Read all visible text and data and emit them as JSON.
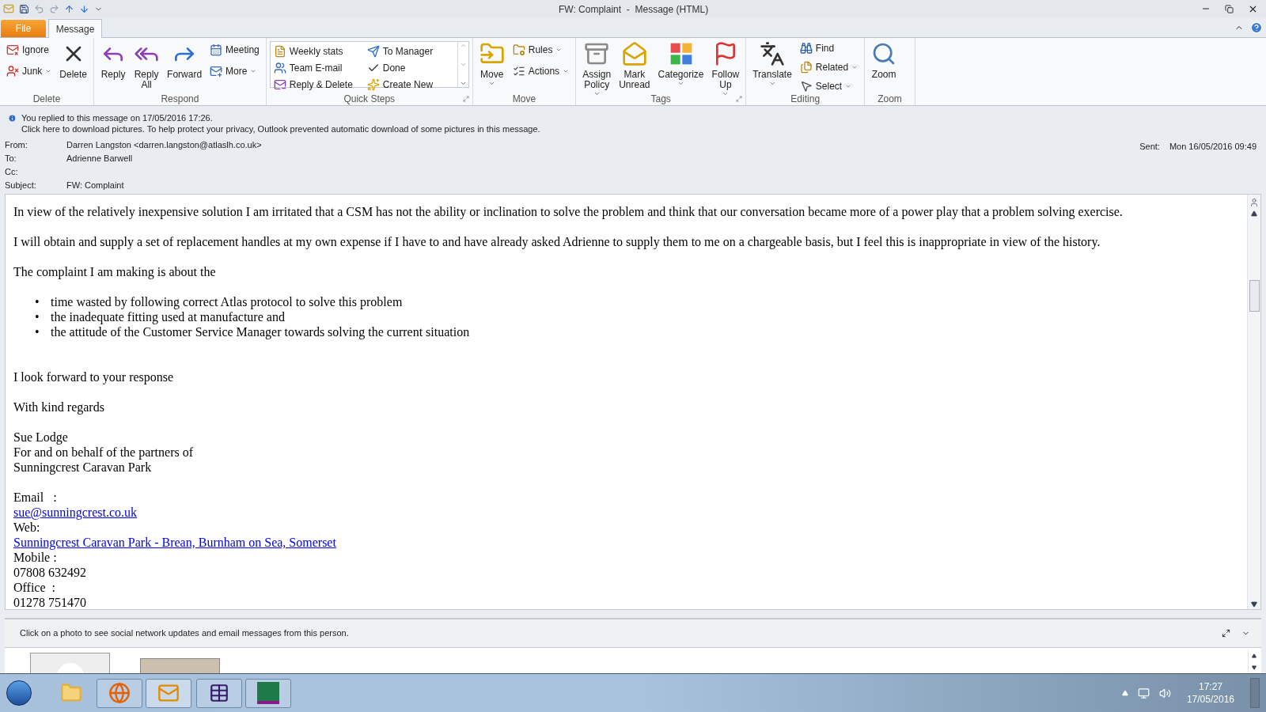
{
  "window": {
    "title": "FW: Complaint  -  Message (HTML)"
  },
  "tabs": [
    {
      "label": "File",
      "kind": "file",
      "selected": false
    },
    {
      "label": "Message",
      "kind": "tab",
      "selected": true
    }
  ],
  "ribbon": {
    "groups": [
      {
        "label": "Delete",
        "launcher": false,
        "items": [
          {
            "kind": "stack",
            "buttons": [
              {
                "label": "Ignore",
                "dropdown": false
              },
              {
                "label": "Junk",
                "dropdown": true
              }
            ]
          },
          {
            "kind": "large",
            "label": "Delete",
            "dropdown": false
          }
        ]
      },
      {
        "label": "Respond",
        "launcher": false,
        "items": [
          {
            "kind": "large",
            "label": "Reply",
            "dropdown": false
          },
          {
            "kind": "large",
            "label": "Reply\nAll",
            "dropdown": false
          },
          {
            "kind": "large",
            "label": "Forward",
            "dropdown": false
          },
          {
            "kind": "stack",
            "buttons": [
              {
                "label": "Meeting",
                "dropdown": false
              },
              {
                "label": "More",
                "dropdown": true
              }
            ]
          }
        ]
      },
      {
        "label": "Quick Steps",
        "launcher": true,
        "items": [
          {
            "kind": "gallery",
            "buttons": [
              {
                "label": "Weekly stats",
                "dropdown": false
              },
              {
                "label": "To Manager",
                "dropdown": false
              },
              {
                "label": "Team E-mail",
                "dropdown": false
              },
              {
                "label": "Done",
                "dropdown": false
              },
              {
                "label": "Reply & Delete",
                "dropdown": false
              },
              {
                "label": "Create New",
                "dropdown": false
              }
            ]
          }
        ]
      },
      {
        "label": "Move",
        "launcher": false,
        "items": [
          {
            "kind": "large",
            "label": "Move",
            "dropdown": true
          },
          {
            "kind": "stack",
            "buttons": [
              {
                "label": "Rules",
                "dropdown": true
              },
              {
                "label": "Actions",
                "dropdown": true
              }
            ]
          }
        ]
      },
      {
        "label": "Tags",
        "launcher": true,
        "items": [
          {
            "kind": "large",
            "label": "Assign\nPolicy",
            "dropdown": true
          },
          {
            "kind": "large",
            "label": "Mark\nUnread",
            "dropdown": false
          },
          {
            "kind": "large",
            "label": "Categorize",
            "dropdown": true
          },
          {
            "kind": "large",
            "label": "Follow\nUp",
            "dropdown": true
          }
        ]
      },
      {
        "label": "Editing",
        "launcher": false,
        "items": [
          {
            "kind": "large",
            "label": "Translate",
            "dropdown": true
          },
          {
            "kind": "stack",
            "buttons": [
              {
                "label": "Find",
                "dropdown": false
              },
              {
                "label": "Related",
                "dropdown": true
              },
              {
                "label": "Select",
                "dropdown": true
              }
            ]
          }
        ]
      },
      {
        "label": "Zoom",
        "launcher": false,
        "items": [
          {
            "kind": "large",
            "label": "Zoom",
            "dropdown": false
          }
        ]
      }
    ]
  },
  "info_bar": [
    "You replied to this message on 17/05/2016 17:26.",
    "Click here to download pictures. To help protect your privacy, Outlook prevented automatic download of some pictures in this message."
  ],
  "headers": [
    {
      "label": "From:",
      "value": "Darren Langston <darren.langston@atlaslh.co.uk>"
    },
    {
      "label": "To:",
      "value": "Adrienne Barwell"
    },
    {
      "label": "Cc:"
    },
    {
      "label": "Subject:",
      "value": "FW: Complaint"
    }
  ],
  "sent": {
    "label": "Sent:",
    "value": "Mon 16/05/2016 09:49"
  },
  "body": [
    {
      "kind": "paragraph",
      "text": "In view of the relatively inexpensive solution I am irritated that a CSM has not the ability or inclination to solve the problem and think that our conversation became more of a power play that a problem solving exercise."
    },
    {
      "kind": "paragraph",
      "text": "I will obtain and supply a set of replacement handles at my own expense if I have to and have already asked Adrienne to supply them to me on a chargeable basis, but I feel this is inappropriate in view of the history."
    },
    {
      "kind": "paragraph",
      "text": "The complaint I am making is about the"
    },
    {
      "kind": "list",
      "marker": "•",
      "items": [
        "time wasted by following correct Atlas protocol to solve this problem",
        "the inadequate fitting used at manufacture and",
        "the attitude of the Customer Service Manager towards solving the current situation"
      ]
    },
    {
      "kind": "paragraph",
      "text": "I look forward to your response"
    },
    {
      "kind": "paragraph",
      "text": "With kind regards"
    },
    {
      "kind": "lines",
      "lines": [
        {
          "text": "Sue Lodge",
          "link": false
        },
        {
          "text": "For and on behalf of the partners of",
          "link": false
        },
        {
          "text": "Sunningcrest Caravan Park",
          "link": false
        }
      ]
    },
    {
      "kind": "lines",
      "lines": [
        {
          "text": "Email   :",
          "link": false
        },
        {
          "text": "sue@sunningcrest.co.uk",
          "link": true
        },
        {
          "text": "Web:",
          "link": false
        },
        {
          "text": "Sunningcrest Caravan Park - Brean, Burnham on Sea, Somerset",
          "link": true
        },
        {
          "text": "Mobile :",
          "link": false
        },
        {
          "text": "07808 632492",
          "link": false
        },
        {
          "text": "Office  :",
          "link": false
        },
        {
          "text": "01278 751470",
          "link": false
        }
      ]
    }
  ],
  "people_pane": {
    "hint": "Click on a photo to see social network updates and email messages from this person.",
    "photos": [
      {
        "kind": "silhouette"
      },
      {
        "kind": "photo"
      }
    ]
  },
  "taskbar": {
    "time": "17:27",
    "date": "17/05/2016"
  }
}
